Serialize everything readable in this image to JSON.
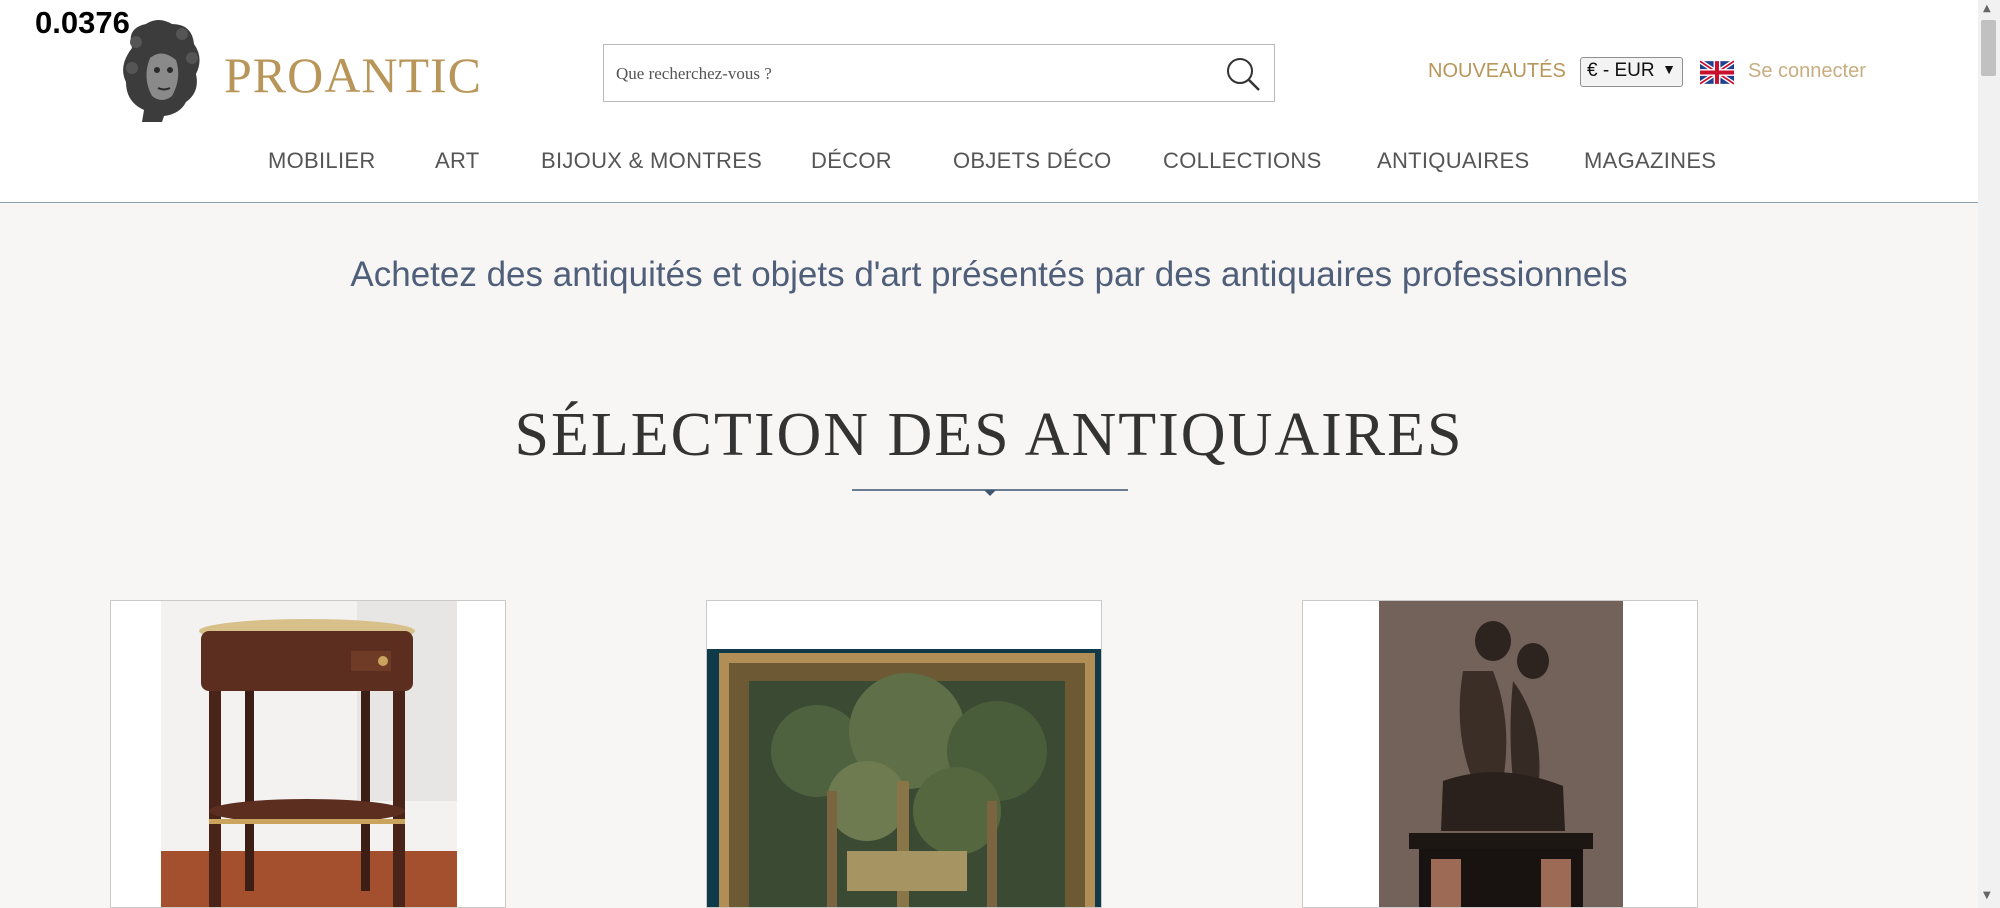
{
  "overlay": {
    "value": "0.0376"
  },
  "brand": {
    "name": "PROANTIC"
  },
  "search": {
    "placeholder": "Que recherchez-vous ?"
  },
  "header": {
    "new_label": "NOUVEAUTÉS",
    "currency": "€ - EUR",
    "login_label": "Se connecter"
  },
  "nav": {
    "items": [
      {
        "label": "MOBILIER"
      },
      {
        "label": "ART"
      },
      {
        "label": "BIJOUX & MONTRES"
      },
      {
        "label": "DÉCOR"
      },
      {
        "label": "OBJETS DÉCO"
      },
      {
        "label": "COLLECTIONS"
      },
      {
        "label": "ANTIQUAIRES"
      },
      {
        "label": "MAGAZINES"
      }
    ]
  },
  "main": {
    "tagline": "Achetez des antiquités et objets d'art présentés par des antiquaires professionnels",
    "section_title": "SÉLECTION DES ANTIQUAIRES"
  },
  "colors": {
    "accent_gold": "#b8965a",
    "tagline_blue": "#4f5f7a",
    "background": "#f7f6f4"
  }
}
